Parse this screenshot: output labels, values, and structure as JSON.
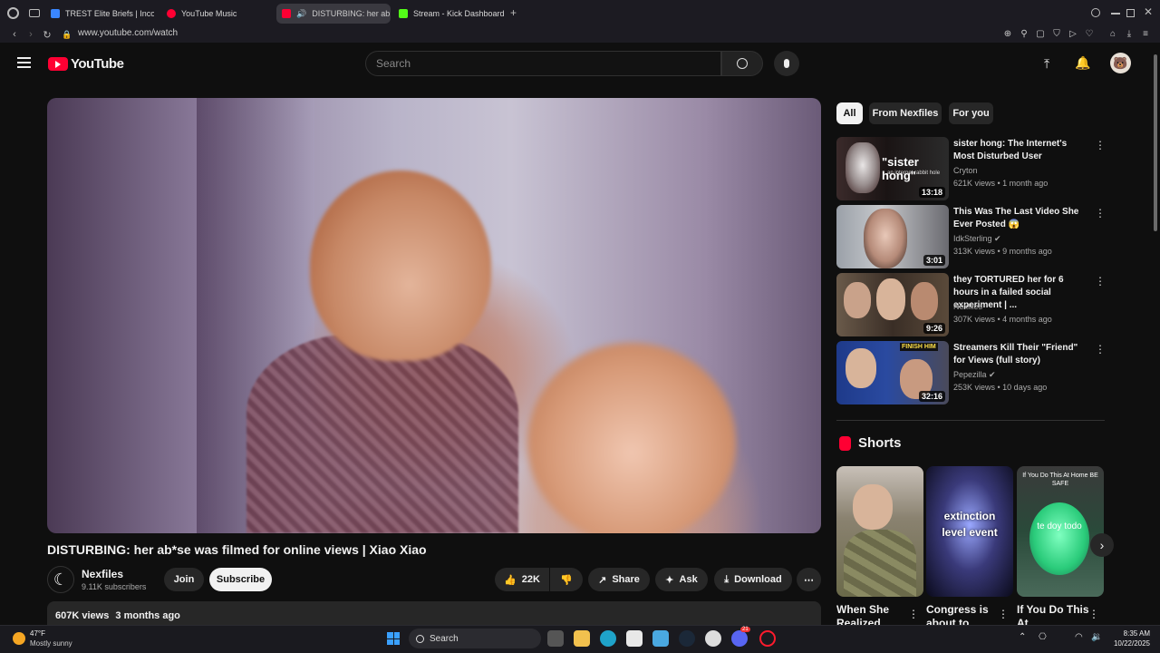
{
  "browser": {
    "tabs": [
      {
        "label": "TREST Elite Briefs | Incon",
        "color": "#3a86ff"
      },
      {
        "label": "YouTube Music",
        "color": "#ff0033"
      },
      {
        "label": "DISTURBING: her ab",
        "color": "#ff0033"
      },
      {
        "label": "Stream - Kick Dashboard",
        "color": "#53fc18"
      }
    ],
    "new_tab_glyph": "+",
    "url": "www.youtube.com/watch"
  },
  "header": {
    "logo_text": "YouTube",
    "search_placeholder": "Search"
  },
  "video": {
    "title": "DISTURBING: her ab*se was filmed for online views | Xiao Xiao",
    "channel": "Nexfiles",
    "subscribers": "9.11K subscribers",
    "join_label": "Join",
    "subscribe_label": "Subscribe",
    "likes": "22K",
    "share_label": "Share",
    "ask_label": "Ask",
    "download_label": "Download",
    "views": "607K views",
    "age": "3 months ago"
  },
  "chips": [
    "All",
    "From Nexfiles",
    "For you"
  ],
  "recommendations": [
    {
      "title": "sister hong: The Internet's Most Disturbed User",
      "channel": "Cryton",
      "meta": "621K views • 1 month ago",
      "duration": "13:18",
      "verified": false,
      "thumb_text": "\"sister hong\"",
      "thumb_sub": "an internet rabbit hole"
    },
    {
      "title": "This Was The Last Video She Ever Posted 😱",
      "channel": "IdkSterling",
      "meta": "313K views • 9 months ago",
      "duration": "3:01",
      "verified": true,
      "thumb_text": "",
      "thumb_sub": ""
    },
    {
      "title": "they TORTURED her for 6 hours in a failed social experiment | ...",
      "channel": "Nexfiles",
      "meta": "307K views • 4 months ago",
      "duration": "9:26",
      "verified": false,
      "thumb_text": "",
      "thumb_sub": ""
    },
    {
      "title": "Streamers Kill Their \"Friend\" for Views (full story)",
      "channel": "Pepezilla",
      "meta": "253K views • 10 days ago",
      "duration": "32:16",
      "verified": true,
      "thumb_text": "FINISH HIM",
      "thumb_sub": ""
    }
  ],
  "shorts": {
    "heading": "Shorts",
    "items": [
      {
        "caption": "When She Realized...",
        "overlay": ""
      },
      {
        "caption": "Congress is about to...",
        "overlay": "extinction level event"
      },
      {
        "caption": "If You Do This At...",
        "overlay": "te doy todo",
        "top_text": "If You Do This At Home BE SAFE"
      }
    ]
  },
  "taskbar": {
    "weather_temp": "47°F",
    "weather_desc": "Mostly sunny",
    "search_label": "Search",
    "time": "8:35 AM",
    "date": "10/22/2025",
    "notification_count": "21"
  }
}
